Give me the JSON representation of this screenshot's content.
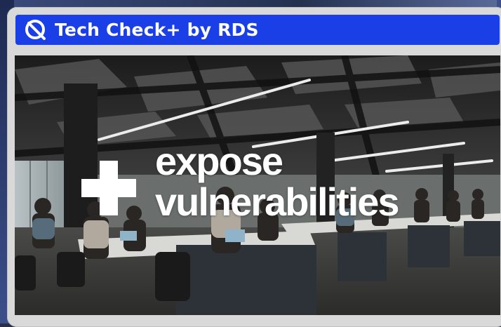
{
  "window": {
    "title": "Tech Check+ by RDS",
    "brand_color": "#1a3fe6",
    "logo_icon": "q-ring-logo-icon"
  },
  "hero": {
    "image_description_icon": "office-photo",
    "plus_icon": "plus-icon",
    "headline_line1": "expose",
    "headline_line2": "vulnerabilities"
  }
}
